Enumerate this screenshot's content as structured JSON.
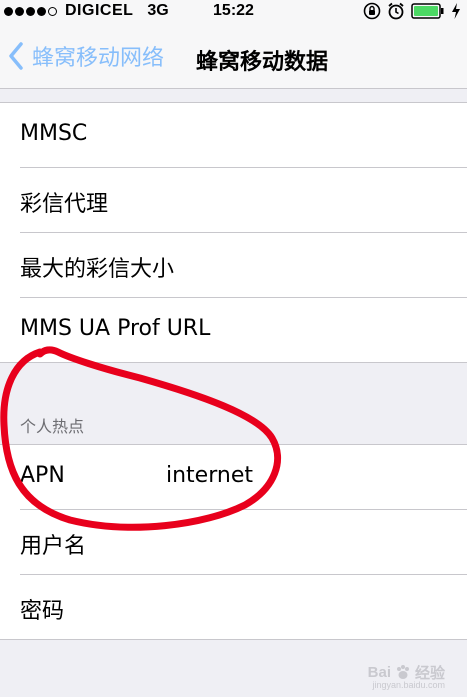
{
  "status_bar": {
    "carrier": "DIGICEL",
    "network": "3G",
    "time": "15:22",
    "signal_bars": 4,
    "icons": [
      "rotation-lock-icon",
      "alarm-icon",
      "battery-icon",
      "charging-icon"
    ]
  },
  "nav": {
    "back_label": "蜂窝移动网络",
    "title": "蜂窝移动数据"
  },
  "mms_group": {
    "rows": [
      {
        "label": "MMSC"
      },
      {
        "label": "彩信代理"
      },
      {
        "label": "最大的彩信大小"
      },
      {
        "label": "MMS UA Prof URL"
      }
    ]
  },
  "hotspot_group": {
    "header": "个人热点",
    "rows": [
      {
        "label": "APN",
        "value": "internet"
      },
      {
        "label": "用户名",
        "value": ""
      },
      {
        "label": "密码",
        "value": ""
      }
    ]
  },
  "watermark": {
    "brand": "Bai",
    "brand_suffix": "经验",
    "site": "jingyan.baidu.com"
  },
  "colors": {
    "accent": "#007aff",
    "battery": "#4cd964",
    "annotation": "#e8001c"
  }
}
